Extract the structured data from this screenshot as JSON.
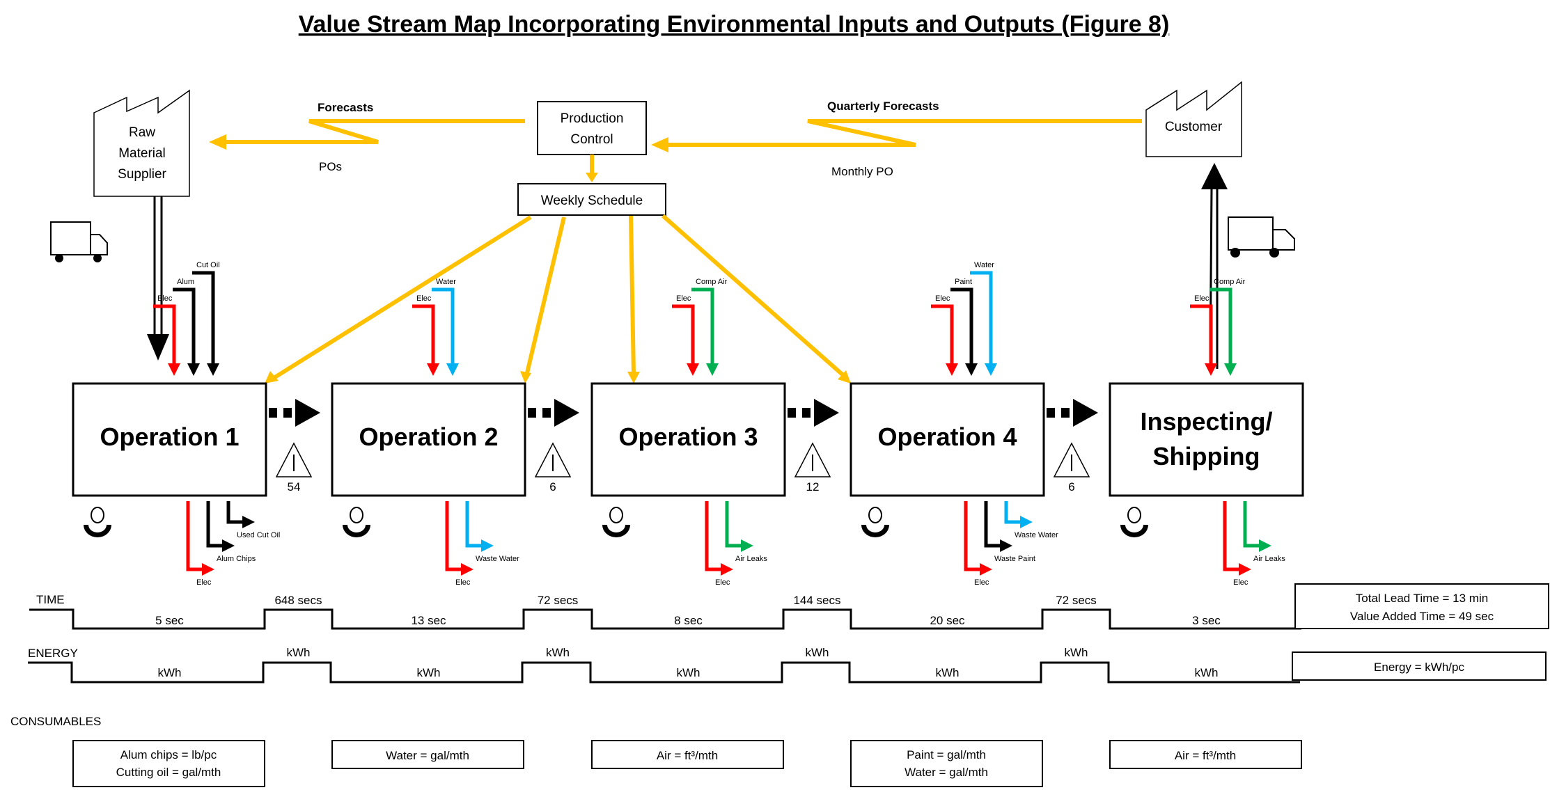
{
  "title": "Value Stream Map Incorporating Environmental Inputs and Outputs (Figure 8)",
  "colors": {
    "info_flow": "#FFC000",
    "electricity": "#FF0000",
    "water": "#00B0F0",
    "comp_air": "#00B050",
    "material": "#000000"
  },
  "supplier": {
    "lines": [
      "Raw",
      "Material",
      "Supplier"
    ],
    "icon": "factory-icon"
  },
  "customer": {
    "label": "Customer",
    "icon": "factory-icon"
  },
  "production_control": {
    "lines": [
      "Production",
      "Control"
    ]
  },
  "weekly_schedule": {
    "label": "Weekly Schedule"
  },
  "info_flows": {
    "forecasts": "Forecasts",
    "pos": "POs",
    "quarterly_forecasts": "Quarterly Forecasts",
    "monthly_po": "Monthly PO"
  },
  "operations": [
    {
      "name": "Operation 1",
      "inputs": [
        {
          "label": "Elec",
          "type": "electricity"
        },
        {
          "label": "Alum",
          "type": "material"
        },
        {
          "label": "Cut Oil",
          "type": "material"
        }
      ],
      "outputs": [
        {
          "label": "Elec",
          "type": "electricity"
        },
        {
          "label": "Alum Chips",
          "type": "material"
        },
        {
          "label": "Used Cut Oil",
          "type": "material"
        }
      ],
      "cycle_time": "5 sec",
      "energy": "kWh",
      "consumables": [
        "Alum chips = lb/pc",
        "Cutting oil = gal/mth"
      ]
    },
    {
      "name": "Operation 2",
      "inputs": [
        {
          "label": "Elec",
          "type": "electricity"
        },
        {
          "label": "Water",
          "type": "water"
        }
      ],
      "outputs": [
        {
          "label": "Elec",
          "type": "electricity"
        },
        {
          "label": "Waste Water",
          "type": "water"
        }
      ],
      "cycle_time": "13 sec",
      "energy": "kWh",
      "consumables": [
        "Water = gal/mth"
      ]
    },
    {
      "name": "Operation 3",
      "inputs": [
        {
          "label": "Elec",
          "type": "electricity"
        },
        {
          "label": "Comp Air",
          "type": "comp_air"
        }
      ],
      "outputs": [
        {
          "label": "Elec",
          "type": "electricity"
        },
        {
          "label": "Air Leaks",
          "type": "comp_air"
        }
      ],
      "cycle_time": "8 sec",
      "energy": "kWh",
      "consumables": [
        "Air = ft³/mth"
      ]
    },
    {
      "name": "Operation 4",
      "inputs": [
        {
          "label": "Elec",
          "type": "electricity"
        },
        {
          "label": "Paint",
          "type": "material"
        },
        {
          "label": "Water",
          "type": "water"
        }
      ],
      "outputs": [
        {
          "label": "Elec",
          "type": "electricity"
        },
        {
          "label": "Waste Paint",
          "type": "material"
        },
        {
          "label": "Waste Water",
          "type": "water"
        }
      ],
      "cycle_time": "20 sec",
      "energy": "kWh",
      "consumables": [
        "Paint = gal/mth",
        "Water = gal/mth"
      ]
    },
    {
      "name_lines": [
        "Inspecting/",
        "Shipping"
      ],
      "inputs": [
        {
          "label": "Elec",
          "type": "electricity"
        },
        {
          "label": "Comp Air",
          "type": "comp_air"
        }
      ],
      "outputs": [
        {
          "label": "Elec",
          "type": "electricity"
        },
        {
          "label": "Air Leaks",
          "type": "comp_air"
        }
      ],
      "cycle_time": "3 sec",
      "energy": "kWh",
      "consumables": [
        "Air = ft³/mth"
      ]
    }
  ],
  "inventory": [
    {
      "symbol": "I",
      "count": "54",
      "wait_time": "648 secs",
      "energy": "kWh"
    },
    {
      "symbol": "I",
      "count": "6",
      "wait_time": "72 secs",
      "energy": "kWh"
    },
    {
      "symbol": "I",
      "count": "12",
      "wait_time": "144 secs",
      "energy": "kWh"
    },
    {
      "symbol": "I",
      "count": "6",
      "wait_time": "72 secs",
      "energy": "kWh"
    }
  ],
  "timeline": {
    "time_label": "TIME",
    "energy_label": "ENERGY",
    "consumables_label": "CONSUMABLES",
    "summary_time": [
      "Total Lead Time = 13 min",
      "Value Added Time = 49 sec"
    ],
    "summary_energy": "Energy = kWh/pc"
  }
}
